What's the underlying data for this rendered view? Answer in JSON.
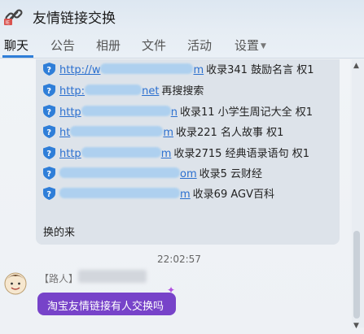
{
  "window": {
    "title": "友情链接交换"
  },
  "tabs": [
    {
      "label": "聊天"
    },
    {
      "label": "公告"
    },
    {
      "label": "相册"
    },
    {
      "label": "文件"
    },
    {
      "label": "活动"
    },
    {
      "label": "设置"
    }
  ],
  "message1": {
    "links": [
      {
        "url_start": "http://w",
        "url_end": "m",
        "desc": "收录341 鼓励名言 权1"
      },
      {
        "url_start": "http:",
        "url_end": "net",
        "desc": "再搜搜索"
      },
      {
        "url_start": "http",
        "url_end": "n",
        "desc": "收录11 小学生周记大全 权1"
      },
      {
        "url_start": "ht",
        "url_end": "m",
        "desc": "收录221 名人故事 权1"
      },
      {
        "url_start": "http",
        "url_end": "m",
        "desc": "收录2715 经典语录语句 权1"
      },
      {
        "url_start": "",
        "url_end": "om",
        "desc": "收录5 云财经"
      },
      {
        "url_start": "",
        "url_end": "m",
        "desc": "收录69 AGV百科"
      }
    ],
    "footer": "换的来"
  },
  "timestamp": "22:02:57",
  "message2": {
    "sender_tag": "【路人】",
    "text": "淘宝友情链接有人交换吗"
  }
}
